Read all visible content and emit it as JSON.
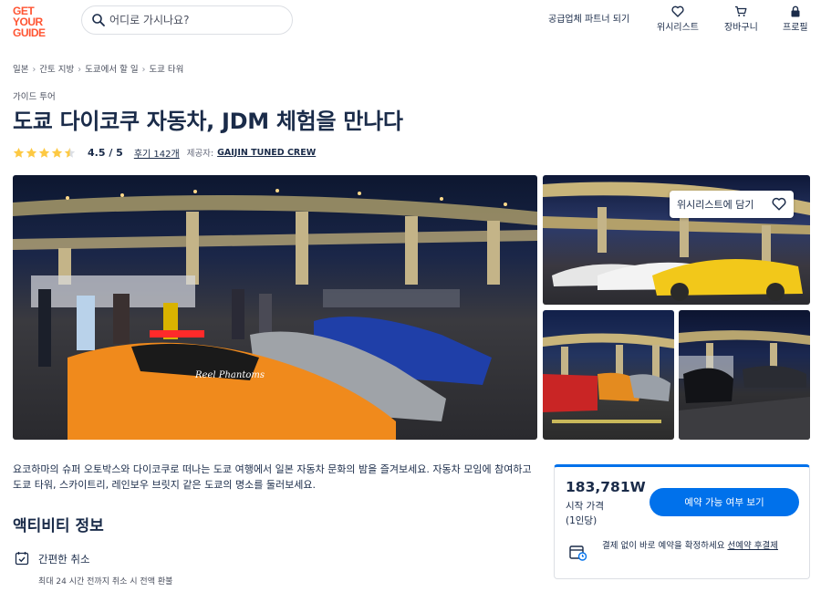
{
  "header": {
    "logo_lines": [
      "GET",
      "YOUR",
      "GUIDE"
    ],
    "search_placeholder": "어디로 가시나요?",
    "partner_link": "공급업체 파트너 되기",
    "wishlist": "위시리스트",
    "cart": "장바구니",
    "profile": "프로필"
  },
  "breadcrumb": [
    "일본",
    "간토 지방",
    "도쿄에서 할 일",
    "도쿄 타워"
  ],
  "product": {
    "type": "가이드 투어",
    "title": "도쿄 다이코쿠 자동차, JDM 체험을 만나다",
    "rating": 4.5,
    "rating_text": "4.5 / 5",
    "reviews": "후기 142개",
    "provider_label": "제공자:",
    "provider": "GAIJIN TUNED CREW"
  },
  "gallery": {
    "wishlist_button": "위시리스트에 담기",
    "main_image_text": "Reel Phantoms"
  },
  "description": "요코하마의 슈퍼 오토박스와 다이코쿠로 떠나는 도쿄 여행에서 일본 자동차 문화의 밤을 즐겨보세요. 자동차 모임에 참여하고 도쿄 타워, 스카이트리, 레인보우 브릿지 같은 도쿄의 명소를 둘러보세요.",
  "activity": {
    "section_title": "액티비티 정보",
    "feature_title": "간편한 취소",
    "feature_sub": "최대 24 시간 전까지 취소 시 전액 환불"
  },
  "booking": {
    "price": "183,781W",
    "price_label": "시작 가격",
    "price_unit": "(1인당)",
    "button": "예약 가능 여부 보기",
    "note": "결제 없이 바로 예약을 확정하세요",
    "note_link": "선예약 후결제"
  },
  "colors": {
    "brand": "#ff5533",
    "primary": "#0071eb",
    "text": "#1a2b49",
    "star": "#fdc943"
  }
}
